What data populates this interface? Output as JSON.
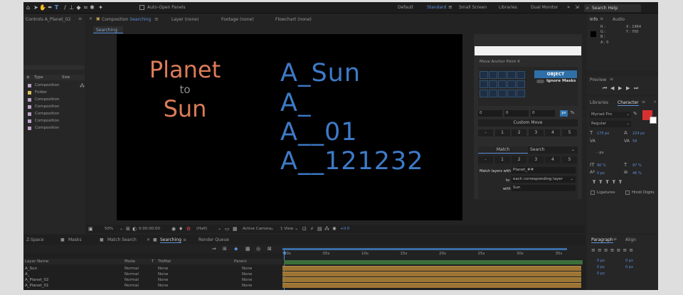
{
  "toolbar": {
    "auto_open_panels": "Auto-Open Panels",
    "workspaces": [
      "Default",
      "Standard",
      "Small Screen",
      "Libraries",
      "Dual Monitor"
    ],
    "active_workspace": "Standard",
    "search_placeholder": "Search Help"
  },
  "project_panel": {
    "title": "Controls A_Planet_02",
    "col_type": "Type",
    "col_size": "Size",
    "items": [
      {
        "type": "Composition",
        "color": "#b8a0c8"
      },
      {
        "type": "Folder",
        "color": "#d8c15c"
      },
      {
        "type": "Composition",
        "color": "#b8a0c8"
      },
      {
        "type": "Composition",
        "color": "#b8a0c8"
      },
      {
        "type": "Composition",
        "color": "#b8a0c8"
      },
      {
        "type": "Composition",
        "color": "#b8a0c8"
      },
      {
        "type": "Composition",
        "color": "#b8a0c8"
      }
    ]
  },
  "viewer_tabs": {
    "composition": "Composition",
    "composition_name": "Searching",
    "layer": "Layer (none)",
    "footage": "Footage (none)",
    "flowchart": "Flowchart (none)",
    "subtab": "Searching"
  },
  "composition_content": {
    "planet": "Planet",
    "to": "to",
    "sun": "Sun",
    "lines": [
      "A_Sun",
      "A_",
      "A__01",
      "A__121232"
    ]
  },
  "viewer_footer": {
    "zoom": "50%",
    "timecode": "0:00:00:00",
    "resolution": "(Half)",
    "camera": "Active Camera",
    "views": "1 View",
    "exposure": "+0.0"
  },
  "motion_tools": {
    "section_title": "Move Anchor Point 4",
    "object_button": "OBJECT",
    "ignore_masks": "Ignore Masks",
    "fields": [
      "0",
      "0",
      "0"
    ],
    "px_label": "px",
    "pct_label": "%",
    "custom_move": "Custom Move",
    "row_buttons": [
      "-",
      "1",
      "2",
      "3",
      "4",
      "5"
    ],
    "match_tab": "Match",
    "search_tab": "Search",
    "match_layers_label": "Match layers with",
    "match_layers_value": "Planet_##",
    "to_label": "to",
    "to_value": "each corresponding layer",
    "with_label": "with",
    "with_value": "Sun"
  },
  "info_panel": {
    "tab_info": "Info",
    "tab_audio": "Audio",
    "r": "R :",
    "g": "G :",
    "b": "B :",
    "a": "A : 0",
    "x": "X : 1964",
    "y": "Y : 700"
  },
  "preview_panel": {
    "title": "Preview"
  },
  "character_panel": {
    "tab_libraries": "Libraries",
    "tab_character": "Character",
    "font": "Myriad Pro",
    "style": "Regular",
    "size": "175 px",
    "leading": "224 px",
    "tracking": "59",
    "unit_px": "- px",
    "vscale": "90 %",
    "hscale": "97 %",
    "baseline": "0 px",
    "tsume": "46 %",
    "ligatures": "Ligatures",
    "hindi_digits": "Hindi Digits",
    "fill_color": "#d83030"
  },
  "paragraph_panel": {
    "tab_paragraph": "Paragraph",
    "tab_align": "Align",
    "v1": "0 px",
    "v2": "0 px",
    "v3": "0 px",
    "v4": "0 px",
    "v5": "0 px"
  },
  "timeline": {
    "tabs": [
      "Z-Space",
      "Masks",
      "Match Search",
      "Searching",
      "Render Queue"
    ],
    "active_tab": "Searching",
    "col_name": "Layer Name",
    "col_mode": "Mode",
    "col_t": "T",
    "col_trkmat": "TrkMat",
    "col_parent": "Parent",
    "ruler": [
      "00s",
      "05s",
      "10s",
      "15s",
      "20s",
      "25s",
      "30s",
      "35s"
    ],
    "layers": [
      {
        "name": "A_Sun",
        "mode": "Normal",
        "trkmat": "None",
        "parent": "None"
      },
      {
        "name": "A_",
        "mode": "Normal",
        "trkmat": "None",
        "parent": "None"
      },
      {
        "name": "A_Planet_02",
        "mode": "Normal",
        "trkmat": "None",
        "parent": "None"
      },
      {
        "name": "A_Planet_01",
        "mode": "Normal",
        "trkmat": "None",
        "parent": "None"
      }
    ]
  }
}
